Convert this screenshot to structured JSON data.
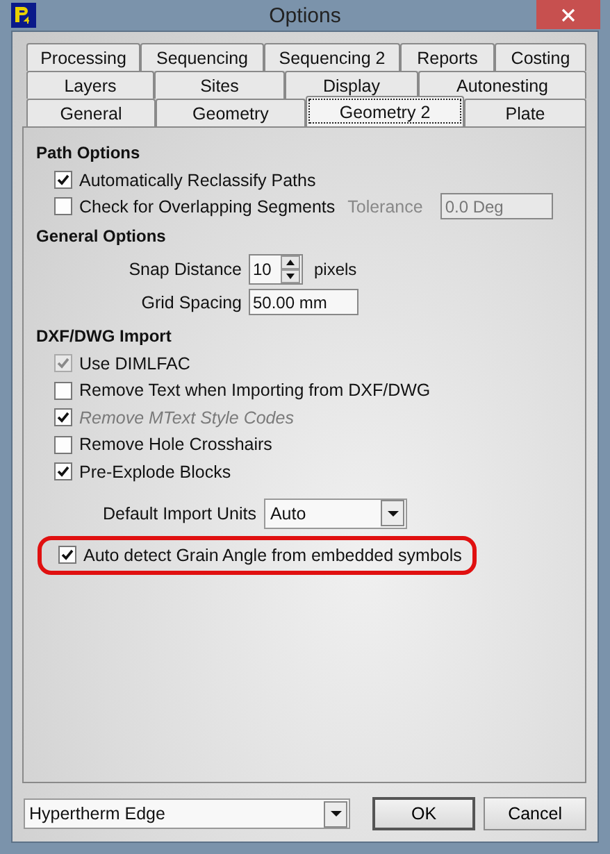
{
  "window": {
    "title": "Options"
  },
  "tab_rows": [
    [
      {
        "label": "Processing",
        "selected": false
      },
      {
        "label": "Sequencing",
        "selected": false
      },
      {
        "label": "Sequencing 2",
        "selected": false
      },
      {
        "label": "Reports",
        "selected": false
      },
      {
        "label": "Costing",
        "selected": false
      }
    ],
    [
      {
        "label": "Layers",
        "selected": false
      },
      {
        "label": "Sites",
        "selected": false
      },
      {
        "label": "Display",
        "selected": false
      },
      {
        "label": "Autonesting",
        "selected": false
      }
    ],
    [
      {
        "label": "General",
        "selected": false
      },
      {
        "label": "Geometry",
        "selected": false
      },
      {
        "label": "Geometry 2",
        "selected": true
      },
      {
        "label": "Plate",
        "selected": false
      }
    ]
  ],
  "path_options": {
    "heading": "Path Options",
    "items": [
      {
        "label": "Automatically Reclassify Paths",
        "checked": true
      },
      {
        "label": "Check for Overlapping Segments",
        "checked": false,
        "tolerance_label": "Tolerance",
        "tolerance_value": "0.0 Deg"
      }
    ]
  },
  "general_options": {
    "heading": "General Options",
    "snap_label": "Snap Distance",
    "snap_value": "10",
    "snap_unit": "pixels",
    "grid_label": "Grid Spacing",
    "grid_value": "50.00 mm"
  },
  "dxf_import": {
    "heading": "DXF/DWG Import",
    "items": [
      {
        "label": "Use DIMLFAC",
        "checked": true,
        "box_disabled": true,
        "label_disabled": false
      },
      {
        "label": "Remove Text when Importing from DXF/DWG",
        "checked": false,
        "box_disabled": false,
        "label_disabled": false
      },
      {
        "label": "Remove MText Style Codes",
        "checked": true,
        "box_disabled": false,
        "label_disabled": true
      },
      {
        "label": "Remove Hole Crosshairs",
        "checked": false,
        "box_disabled": false,
        "label_disabled": false
      },
      {
        "label": "Pre-Explode Blocks",
        "checked": true,
        "box_disabled": false,
        "label_disabled": false
      }
    ],
    "units_label": "Default Import Units",
    "units_value": "Auto",
    "grain": {
      "label": "Auto detect Grain Angle from embedded symbols",
      "checked": true,
      "highlighted": true
    }
  },
  "footer": {
    "profile": "Hypertherm Edge",
    "buttons": [
      "OK",
      "Cancel"
    ]
  }
}
